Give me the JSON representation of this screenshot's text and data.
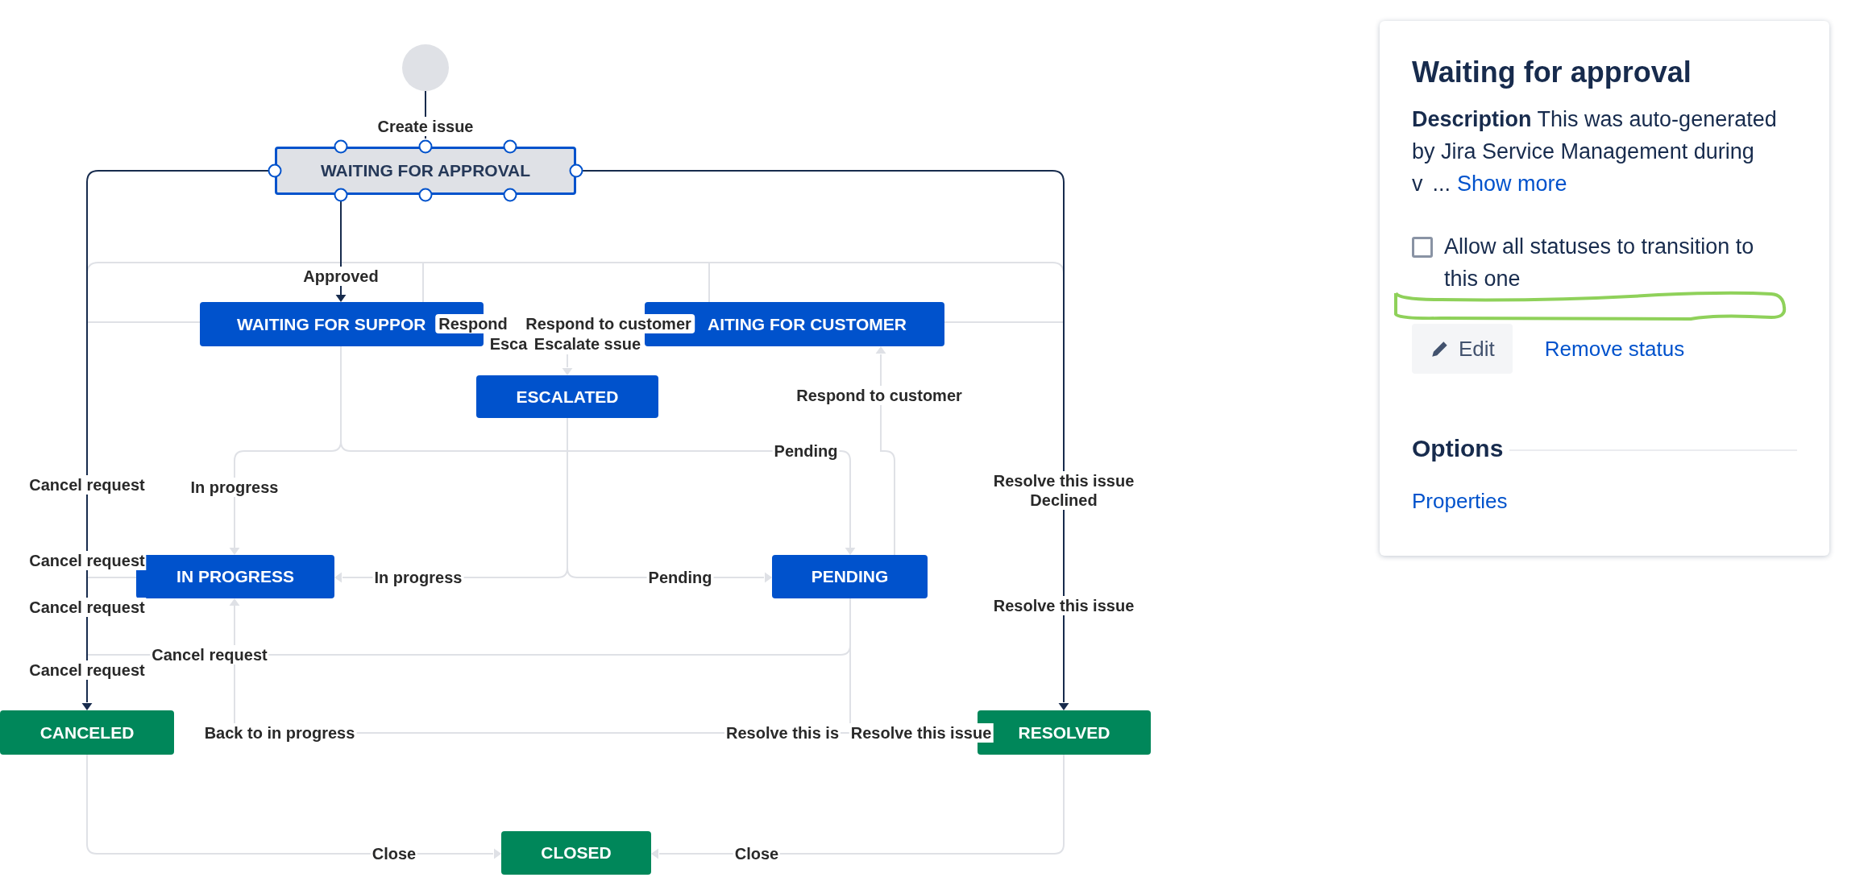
{
  "diagram": {
    "statuses": [
      {
        "label": "WAITING FOR APPROVAL",
        "kind": "todo",
        "selected": true
      },
      {
        "label": "WAITING FOR SUPPOR",
        "kind": "inprogress",
        "selected": false
      },
      {
        "label": "AITING FOR CUSTOMER",
        "kind": "inprogress",
        "selected": false
      },
      {
        "label": "ESCALATED",
        "kind": "inprogress",
        "selected": false
      },
      {
        "label": "IN PROGRESS",
        "kind": "inprogress",
        "selected": false
      },
      {
        "label": "PENDING",
        "kind": "inprogress",
        "selected": false
      },
      {
        "label": "CANCELED",
        "kind": "done",
        "selected": false
      },
      {
        "label": "RESOLVED",
        "kind": "done",
        "selected": false
      },
      {
        "label": "CLOSED",
        "kind": "done",
        "selected": false
      }
    ],
    "transitions": [
      "Create issue",
      "Approved",
      "Respond",
      "Respond to customer",
      "Esca",
      "Escalate ssue",
      "Respond to customer",
      "Pending",
      "Cancel request",
      "In progress",
      "Resolve this issue",
      "Declined",
      "Cancel request",
      "In progress",
      "Pending",
      "Cancel request",
      "Resolve this issue",
      "Cancel request",
      "Cancel request",
      "Back to in progress",
      "Resolve this is",
      "Resolve this issue",
      "Close",
      "Close"
    ]
  },
  "panel": {
    "title": "Waiting for approval",
    "description": "**Description** This was auto-generated by Jira Service Management during v",
    "ellipsis": "...",
    "show_more": "Show more",
    "checkbox": {
      "label": "Allow all statuses to transition to this one",
      "checked": false
    },
    "edit_button": "Edit",
    "remove_link": "Remove status",
    "options": {
      "heading": "Options",
      "links": [
        "Properties"
      ]
    }
  }
}
